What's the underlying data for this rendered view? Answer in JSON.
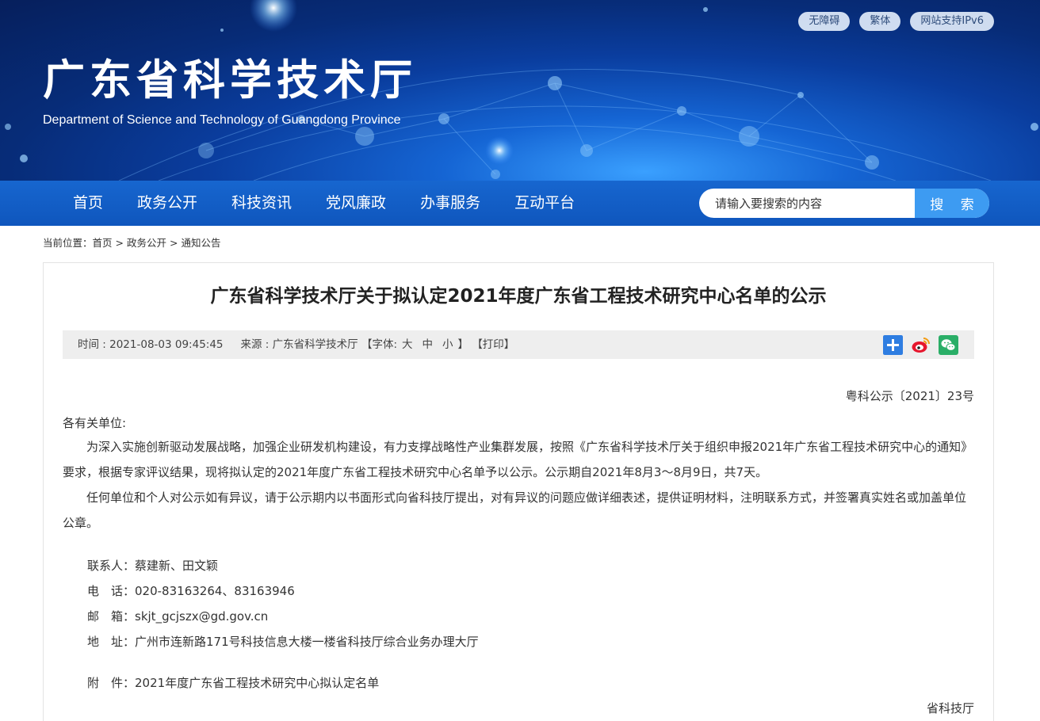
{
  "header": {
    "site_title": "广东省科学技术厅",
    "site_subtitle": "Department of Science and Technology of Guangdong Province",
    "top_links": [
      "无障碍",
      "繁体",
      "网站支持IPv6"
    ]
  },
  "nav": {
    "items": [
      "首页",
      "政务公开",
      "科技资讯",
      "党风廉政",
      "办事服务",
      "互动平台"
    ],
    "search_placeholder": "请输入要搜索的内容",
    "search_button": "搜 索"
  },
  "breadcrumb": {
    "prefix": "当前位置：",
    "items": [
      "首页",
      "政务公开",
      "通知公告"
    ],
    "separator": ">"
  },
  "article": {
    "title": "广东省科学技术厅关于拟认定2021年度广东省工程技术研究中心名单的公示",
    "meta": {
      "time": "时间 : 2021-08-03 09:45:45",
      "source": "来源 : 广东省科学技术厅",
      "font_open": "【字体:",
      "font_large": "大",
      "font_medium": "中",
      "font_small": "小",
      "font_close": "】",
      "print": "【打印】"
    },
    "doc_number": "粤科公示〔2021〕23号",
    "salutation": "各有关单位:",
    "paragraphs": [
      "为深入实施创新驱动发展战略，加强企业研发机构建设，有力支撑战略性产业集群发展，按照《广东省科学技术厅关于组织申报2021年广东省工程技术研究中心的通知》要求，根据专家评议结果，现将拟认定的2021年度广东省工程技术研究中心名单予以公示。公示期自2021年8月3～8月9日，共7天。",
      "任何单位和个人对公示如有异议，请于公示期内以书面形式向省科技厅提出，对有异议的问题应做详细表述，提供证明材料，注明联系方式，并签署真实姓名或加盖单位公章。"
    ],
    "contacts": [
      {
        "label": "联系人：",
        "value": "蔡建新、田文颖"
      },
      {
        "label": "电　话：",
        "value": "020-83163264、83163946"
      },
      {
        "label": "邮　箱：",
        "value": "skjt_gcjszx@gd.gov.cn"
      },
      {
        "label": "地　址：",
        "value": "广州市连新路171号科技信息大楼一楼省科技厅综合业务办理大厅"
      }
    ],
    "attachment": {
      "label": "附　件：",
      "value": "2021年度广东省工程技术研究中心拟认定名单"
    },
    "signer": "省科技厅"
  },
  "share_icons": [
    "share-plus-icon",
    "weibo-icon",
    "wechat-icon"
  ],
  "colors": {
    "banner_dark": "#061f5c",
    "nav_blue": "#1766cf",
    "search_button": "#3d9bf2",
    "meta_bar": "#eeeeee"
  }
}
